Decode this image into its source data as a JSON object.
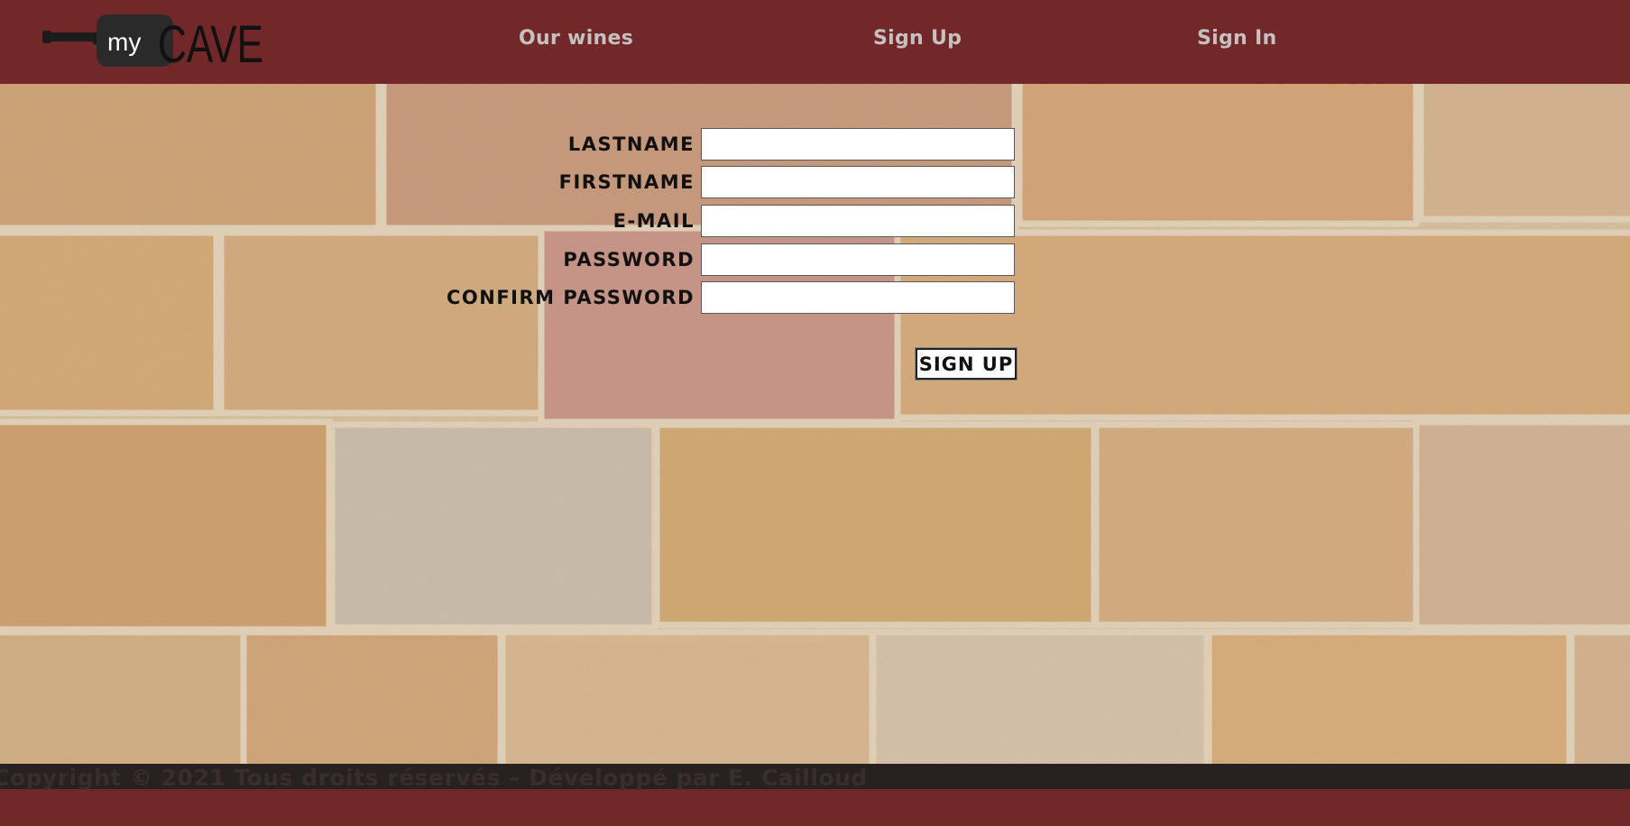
{
  "header": {
    "logo": {
      "prefix": "my",
      "name": "CAVE",
      "icon": "wine-bottle-icon"
    },
    "nav": {
      "wines": "Our wines",
      "signup": "Sign Up",
      "signin": "Sign In"
    }
  },
  "form": {
    "lastname_label": "LASTNAME",
    "firstname_label": "FIRSTNAME",
    "email_label": "E-MAIL",
    "password_label": "PASSWORD",
    "confirm_label": "CONFIRM PASSWORD",
    "lastname_value": "",
    "firstname_value": "",
    "email_value": "",
    "password_value": "",
    "confirm_value": "",
    "submit_label": "SIGN UP"
  },
  "footer": {
    "text": "Copyright © 2021 Tous droits réservés – Développé par E. Cailloud"
  },
  "colors": {
    "header_bg": "#722829",
    "nav_text": "#c5c1c1",
    "footer_band": "#272122",
    "wall_base": "#cfa878"
  }
}
